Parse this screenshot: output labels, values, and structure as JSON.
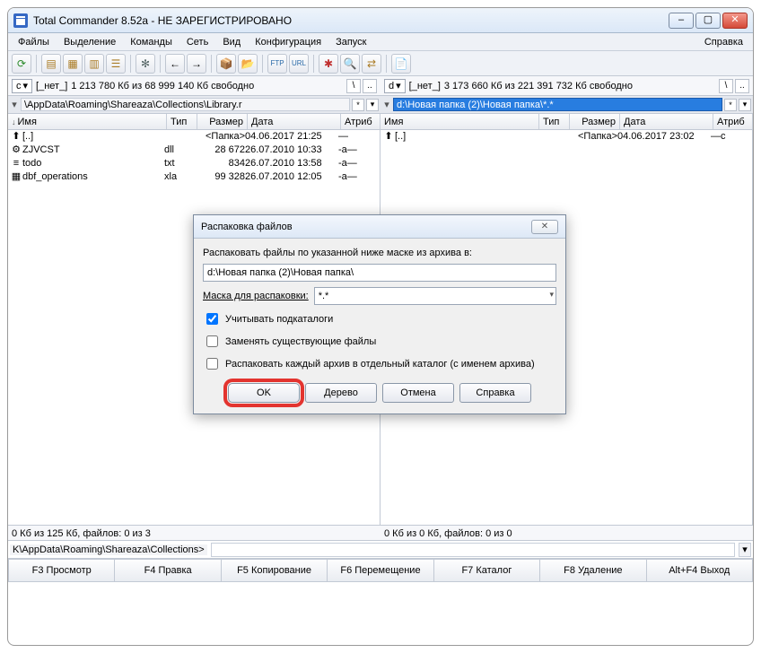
{
  "window": {
    "title": "Total Commander 8.52a - НЕ ЗАРЕГИСТРИРОВАНО"
  },
  "menu": {
    "items": [
      "Файлы",
      "Выделение",
      "Команды",
      "Сеть",
      "Вид",
      "Конфигурация",
      "Запуск"
    ],
    "help": "Справка"
  },
  "left": {
    "drive_letter": "c",
    "drive_label": "[_нет_]",
    "free": "1 213 780 Кб из 68 999 140 Кб свободно",
    "path": "\\AppData\\Roaming\\Shareaza\\Collections\\Library.r",
    "files": [
      {
        "icon": "⬆",
        "name": "[..]",
        "ext": "",
        "size": "<Папка>",
        "date": "04.06.2017 21:25",
        "attr": "—"
      },
      {
        "icon": "⚙",
        "name": "ZJVCST",
        "ext": "dll",
        "size": "28 672",
        "date": "26.07.2010 10:33",
        "attr": "-a—"
      },
      {
        "icon": "≡",
        "name": "todo",
        "ext": "txt",
        "size": "834",
        "date": "26.07.2010 13:58",
        "attr": "-a—"
      },
      {
        "icon": "▦",
        "name": "dbf_operations",
        "ext": "xla",
        "size": "99 328",
        "date": "26.07.2010 12:05",
        "attr": "-a—"
      }
    ],
    "status": "0 Кб из 125 Кб, файлов: 0 из 3"
  },
  "right": {
    "drive_letter": "d",
    "drive_label": "[_нет_]",
    "free": "3 173 660 Кб из 221 391 732 Кб свободно",
    "path": "d:\\Новая папка (2)\\Новая папка\\*.*",
    "files": [
      {
        "icon": "⬆",
        "name": "[..]",
        "ext": "",
        "size": "<Папка>",
        "date": "04.06.2017 23:02",
        "attr": "—c"
      }
    ],
    "status": "0 Кб из 0 Кб, файлов: 0 из 0"
  },
  "columns": {
    "name": "Имя",
    "ext": "Тип",
    "size": "Размер",
    "date": "Дата",
    "attr": "Атриб"
  },
  "cmdline": {
    "cwd": "K\\AppData\\Roaming\\Shareaza\\Collections>",
    "value": ""
  },
  "fkeys": [
    "F3 Просмотр",
    "F4 Правка",
    "F5 Копирование",
    "F6 Перемещение",
    "F7 Каталог",
    "F8 Удаление",
    "Alt+F4 Выход"
  ],
  "dialog": {
    "title": "Распаковка файлов",
    "label_dest": "Распаковать файлы по указанной ниже маске из архива в:",
    "dest": "d:\\Новая папка (2)\\Новая папка\\",
    "mask_label": "Маска для распаковки:",
    "mask_value": "*.*",
    "chk_subdirs": "Учитывать подкаталоги",
    "chk_subdirs_checked": true,
    "chk_overwrite": "Заменять существующие файлы",
    "chk_overwrite_checked": false,
    "chk_separate": "Распаковать каждый архив в отдельный каталог (с именем архива)",
    "chk_separate_checked": false,
    "btn_ok": "OK",
    "btn_tree": "Дерево",
    "btn_cancel": "Отмена",
    "btn_help": "Справка"
  }
}
